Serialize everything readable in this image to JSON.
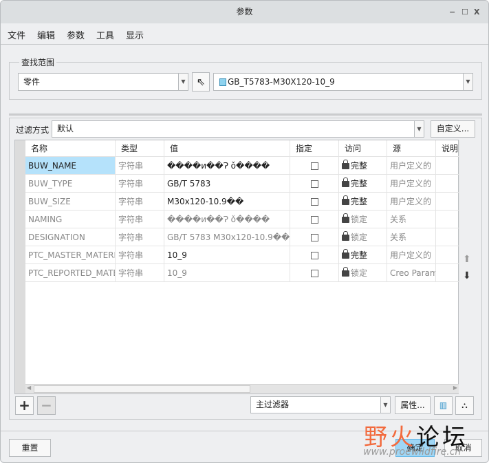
{
  "window": {
    "title": "参数",
    "min": "−",
    "max": "☐",
    "close": "X"
  },
  "menu": [
    "文件",
    "编辑",
    "参数",
    "工具",
    "显示"
  ],
  "scope": {
    "legend": "查找范围",
    "type_value": "零件",
    "model_value": "GB_T5783-M30X120-10_9"
  },
  "filter": {
    "label": "过滤方式",
    "value": "默认",
    "customize": "自定义..."
  },
  "table": {
    "columns": [
      "名称",
      "类型",
      "值",
      "指定",
      "访问",
      "源",
      "说明"
    ],
    "rows": [
      {
        "name": "BUW_NAME",
        "type": "字符串",
        "value": "����и��Ɂ ǒ����",
        "access": "完整",
        "source": "用户定义的",
        "locked": false
      },
      {
        "name": "BUW_TYPE",
        "type": "字符串",
        "value": "GB/T 5783",
        "access": "完整",
        "source": "用户定义的",
        "locked": false
      },
      {
        "name": "BUW_SIZE",
        "type": "字符串",
        "value": "M30x120-10.9��",
        "access": "完整",
        "source": "用户定义的",
        "locked": false
      },
      {
        "name": "NAMING",
        "type": "字符串",
        "value": "����и��Ɂ ǒ����",
        "access": "锁定",
        "source": "关系",
        "locked": true
      },
      {
        "name": "DESIGNATION",
        "type": "字符串",
        "value": "GB/T 5783 M30x120-10.9��",
        "access": "锁定",
        "source": "关系",
        "locked": true
      },
      {
        "name": "PTC_MASTER_MATERIAL",
        "type": "字符串",
        "value": "10_9",
        "access": "完整",
        "source": "用户定义的",
        "locked": false
      },
      {
        "name": "PTC_REPORTED_MATERIAL",
        "type": "字符串",
        "value": "10_9",
        "access": "锁定",
        "source": "Creo Parametric",
        "locked": true
      }
    ]
  },
  "bottom_bar": {
    "filter_value": "主过滤器",
    "properties": "属性..."
  },
  "footer": {
    "reset": "重置",
    "ok": "确定",
    "cancel": "取消"
  },
  "watermark": {
    "text": "野火论坛",
    "url": "www.proewildfire.cn"
  }
}
